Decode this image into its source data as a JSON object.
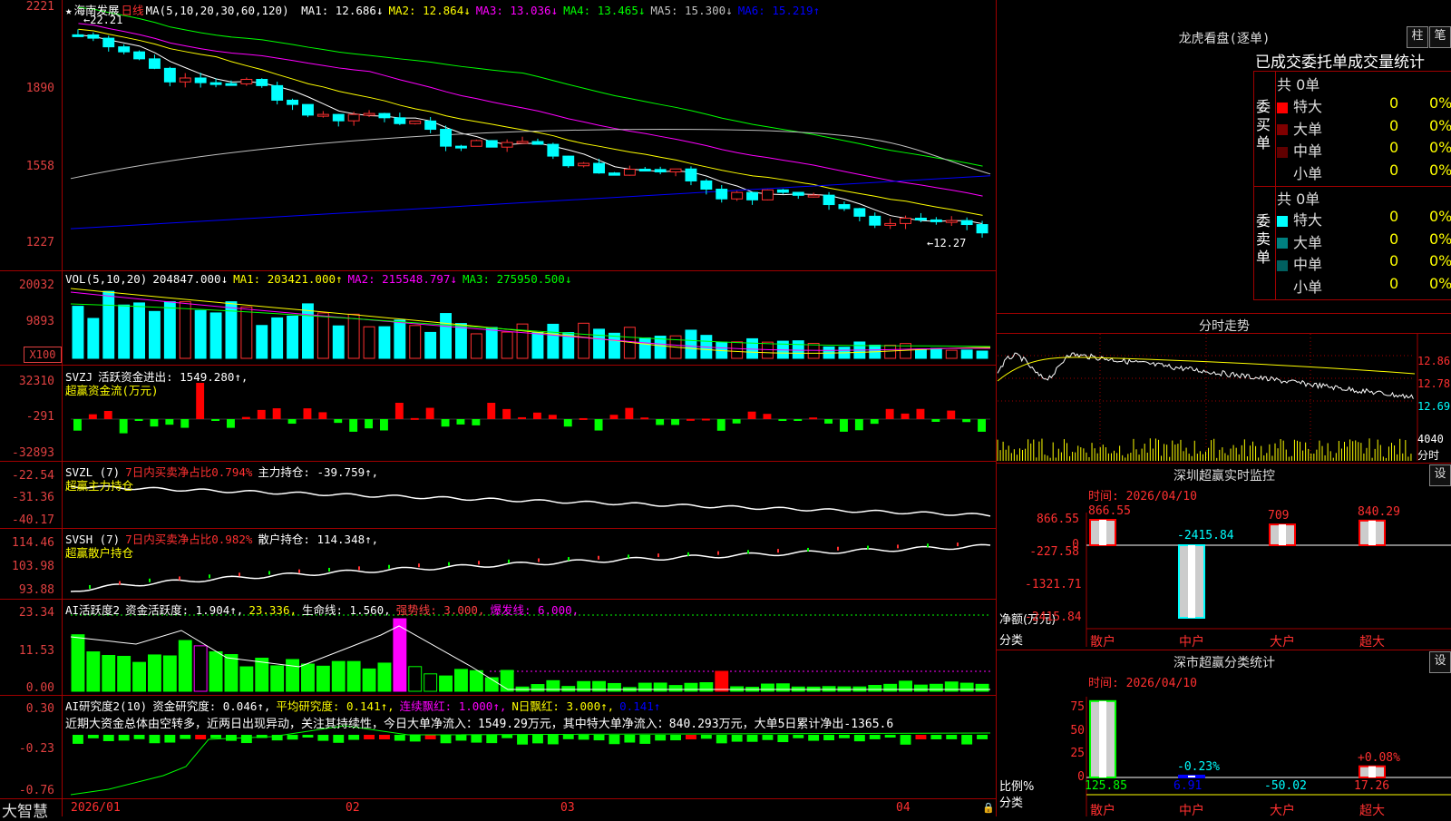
{
  "app": {
    "brand": "大智慧"
  },
  "kline": {
    "flag_icon": "star-icon",
    "stock_name": "海南发展",
    "period": "日线",
    "ma_title": "MA(5,10,20,30,60,120)",
    "ma_values": [
      {
        "label": "MA1: 12.686↓",
        "color": "#ffffff"
      },
      {
        "label": "MA2: 12.864↓",
        "color": "#ffff00"
      },
      {
        "label": "MA3: 13.036↓",
        "color": "#ff00ff"
      },
      {
        "label": "MA4: 13.465↓",
        "color": "#00ff00"
      },
      {
        "label": "MA5: 15.300↓",
        "color": "#c0c0c0"
      },
      {
        "label": "MA6: 15.219↑",
        "color": "#0000ff"
      }
    ],
    "y_ticks": [
      "2221",
      "1890",
      "1558",
      "1227"
    ],
    "high_marker": "22.21",
    "low_marker": "12.27",
    "high_price": 22.21,
    "low_price": 12.27
  },
  "volume": {
    "title": "VOL(5,10,20)",
    "value": "204847.000↓",
    "ma_values": [
      {
        "label": "MA1: 203421.000↑",
        "color": "#ffff00"
      },
      {
        "label": "MA2: 215548.797↓",
        "color": "#ff00ff"
      },
      {
        "label": "MA3: 275950.500↓",
        "color": "#00ff00"
      }
    ],
    "y_ticks": [
      "20032",
      "9893"
    ],
    "unit": "X100"
  },
  "svzj": {
    "title": "SVZJ",
    "line1": "活跃资金进出: 1549.280↑,",
    "line2": "超赢资金流(万元)",
    "y_ticks": [
      "32310",
      "-291",
      "-32893"
    ]
  },
  "svzl": {
    "title": "SVZL (7)",
    "ratio": "7日内买卖净占比0.794%",
    "holding": "主力持仓: -39.759↑,",
    "line2": "超赢主力持仓",
    "y_ticks": [
      "-22.54",
      "-31.36",
      "-40.17"
    ]
  },
  "svsh": {
    "title": "SVSH (7)",
    "ratio": "7日内买卖净占比0.982%",
    "holding": "散户持仓: 114.348↑,",
    "line2": "超赢散户持仓",
    "y_ticks": [
      "114.46",
      "103.98",
      "93.88"
    ]
  },
  "ai_activity": {
    "title": "AI活跃度2",
    "items": [
      {
        "label": "资金活跃度: 1.904↑,",
        "color": "#ffffff"
      },
      {
        "label": "23.336,",
        "color": "#ffff00"
      },
      {
        "label": "生命线: 1.560,",
        "color": "#ffffff"
      },
      {
        "label": "强势线: 3.000,",
        "color": "#ff4040"
      },
      {
        "label": "爆发线: 6.000,",
        "color": "#ff00ff"
      }
    ],
    "y_ticks": [
      "23.34",
      "11.53",
      "0.00"
    ]
  },
  "ai_research": {
    "title": "AI研究度2(10)",
    "items": [
      {
        "label": "资金研究度: 0.046↑,",
        "color": "#ffffff"
      },
      {
        "label": "平均研究度: 0.141↑,",
        "color": "#ffff00"
      },
      {
        "label": "连续飘红: 1.000↑,",
        "color": "#ff00ff"
      },
      {
        "label": "N日飘红: 3.000↑,",
        "color": "#ffff00"
      },
      {
        "label": "0.141↑",
        "color": "#0000ff"
      }
    ],
    "comment": "近期大资金总体由空转多，近两日出现异动，关注其持续性，今日大单净流入：1549.29万元，其中特大单净流入：840.293万元，大单5日累计净出-1365.6",
    "y_ticks": [
      "0.30",
      "-0.23",
      "-0.76"
    ]
  },
  "date_axis": [
    "2026/01",
    "02",
    "03",
    "04"
  ],
  "dragon_tiger": {
    "title": "龙虎看盘(逐单)",
    "btn_bar": "柱",
    "btn_detail": "笔",
    "subtitle": "已成交委托单成交量统计",
    "buy_side": {
      "label": "委买单",
      "total": "共 0单",
      "rows": [
        {
          "name": "特大",
          "value": "0",
          "pct": "0%",
          "color": "#ff0000"
        },
        {
          "name": "大单",
          "value": "0",
          "pct": "0%",
          "color": "#800000"
        },
        {
          "name": "中单",
          "value": "0",
          "pct": "0%",
          "color": "#600000"
        },
        {
          "name": "小单",
          "value": "0",
          "pct": "0%",
          "color": ""
        }
      ]
    },
    "sell_side": {
      "label": "委卖单",
      "total": "共 0单",
      "rows": [
        {
          "name": "特大",
          "value": "0",
          "pct": "0%",
          "color": "#00ffff"
        },
        {
          "name": "大单",
          "value": "0",
          "pct": "0%",
          "color": "#008080"
        },
        {
          "name": "中单",
          "value": "0",
          "pct": "0%",
          "color": "#006060"
        },
        {
          "name": "小单",
          "value": "0",
          "pct": "0%",
          "color": ""
        }
      ]
    }
  },
  "intraday": {
    "title": "分时走势",
    "price_ticks": [
      "12.86",
      "12.78",
      "12.69"
    ],
    "vol_ticks": [
      "4040",
      "分时"
    ]
  },
  "sz_monitor": {
    "title": "深圳超赢实时监控",
    "settings": "设",
    "time": "时间: 2026/04/10",
    "y_ticks": [
      "866.55",
      "0",
      "-227.58",
      "-1321.71",
      "-2415.84"
    ],
    "y_unit": "净额(万元)",
    "x_unit": "分类",
    "categories": [
      "散户",
      "中户",
      "大户",
      "超大"
    ],
    "values": [
      866.55,
      -2415.84,
      709,
      840.29
    ],
    "value_labels": [
      "866.55",
      "-2415.84",
      "709",
      "840.29"
    ]
  },
  "sz_classify": {
    "title": "深市超赢分类统计",
    "settings": "设",
    "time": "时间: 2026/04/10",
    "y_ticks": [
      "75",
      "50",
      "25",
      "0"
    ],
    "y_unit": "比例%",
    "x_unit": "分类",
    "categories": [
      "散户",
      "中户",
      "大户",
      "超大"
    ],
    "bottom_values": [
      "125.85",
      "6.91",
      "-50.02",
      "17.26"
    ],
    "bar_labels": [
      "",
      "-0.23%",
      "",
      "+0.08%"
    ]
  },
  "colors": {
    "up": "#ff3030",
    "down": "#00ffff",
    "frame": "#a00000"
  }
}
